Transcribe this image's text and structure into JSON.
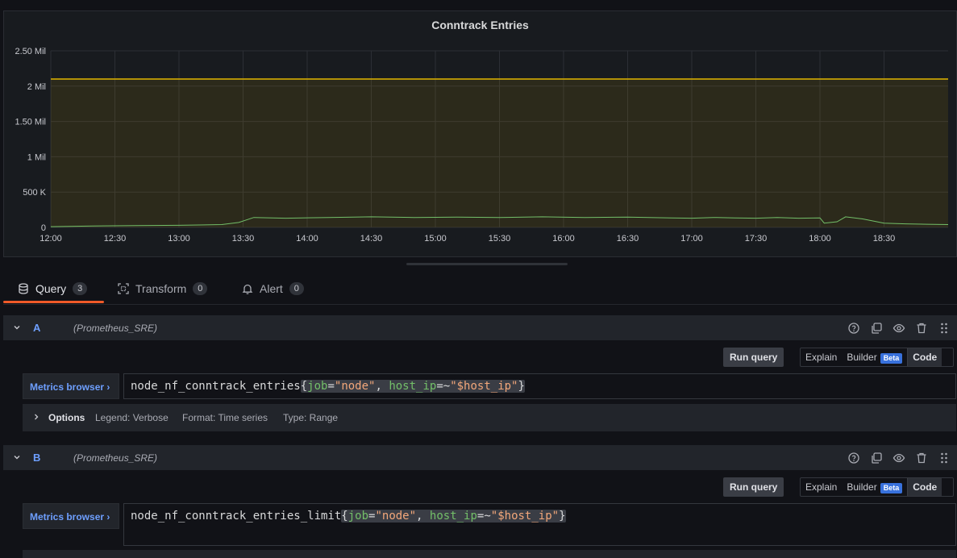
{
  "panel": {
    "title": "Conntrack Entries"
  },
  "chart_data": {
    "type": "line",
    "title": "Conntrack Entries",
    "y_ticks": [
      "2.50 Mil",
      "2 Mil",
      "1.50 Mil",
      "1 Mil",
      "500 K",
      "0"
    ],
    "x_ticks": [
      "12:00",
      "12:30",
      "13:00",
      "13:30",
      "14:00",
      "14:30",
      "15:00",
      "15:30",
      "16:00",
      "16:30",
      "17:00",
      "17:30",
      "18:00",
      "18:30"
    ],
    "ylim": [
      0,
      2500000
    ],
    "xlim_minutes_after_12": [
      0,
      420
    ],
    "grid": true,
    "series": [
      {
        "color": "#73bf69",
        "fill": false,
        "x": [
          0,
          20,
          40,
          60,
          80,
          88,
          95,
          110,
          130,
          150,
          170,
          190,
          210,
          230,
          250,
          270,
          290,
          300,
          310,
          320,
          330,
          340,
          350,
          360,
          362,
          368,
          372,
          380,
          390,
          400,
          410,
          420
        ],
        "y": [
          10000,
          20000,
          25000,
          30000,
          40000,
          70000,
          140000,
          130000,
          140000,
          150000,
          140000,
          145000,
          140000,
          150000,
          140000,
          145000,
          135000,
          130000,
          140000,
          135000,
          130000,
          140000,
          130000,
          135000,
          60000,
          80000,
          150000,
          120000,
          60000,
          50000,
          45000,
          40000
        ]
      },
      {
        "color": "#e0b400",
        "fill": true,
        "y_constant": 2100000
      }
    ]
  },
  "tabs": [
    {
      "label": "Query",
      "count": "3"
    },
    {
      "label": "Transform",
      "count": "0"
    },
    {
      "label": "Alert",
      "count": "0"
    }
  ],
  "queries": [
    {
      "name": "A",
      "datasource": "(Prometheus_SRE)",
      "run_label": "Run query",
      "modes": {
        "explain": "Explain",
        "builder": "Builder",
        "beta": "Beta",
        "code": "Code"
      },
      "metrics_browser": "Metrics browser",
      "expr": {
        "metric": "node_nf_conntrack_entries",
        "l1": "job",
        "v1": "\"node\"",
        "l2": "host_ip",
        "op2": "=~",
        "v2": "\"$host_ip\""
      },
      "options": {
        "title": "Options",
        "legend": "Legend: Verbose",
        "format": "Format: Time series",
        "type": "Type: Range"
      }
    },
    {
      "name": "B",
      "datasource": "(Prometheus_SRE)",
      "run_label": "Run query",
      "modes": {
        "explain": "Explain",
        "builder": "Builder",
        "beta": "Beta",
        "code": "Code"
      },
      "metrics_browser": "Metrics browser",
      "expr": {
        "metric": "node_nf_conntrack_entries_limit",
        "l1": "job",
        "v1": "\"node\"",
        "l2": "host_ip",
        "op2": "=~",
        "v2": "\"$host_ip\""
      }
    }
  ]
}
